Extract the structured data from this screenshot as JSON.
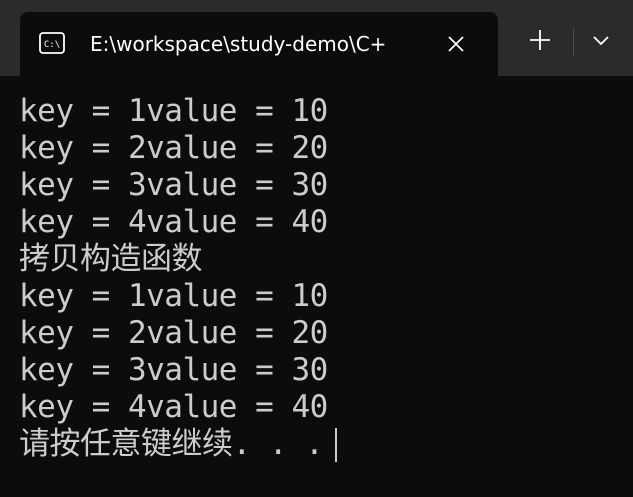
{
  "tab": {
    "title": "E:\\workspace\\study-demo\\C+",
    "icon": "terminal-icon",
    "close_icon": "close-icon"
  },
  "toolbar": {
    "new_tab_icon": "plus-icon",
    "dropdown_icon": "chevron-down-icon"
  },
  "console": {
    "lines": [
      "key = 1value = 10",
      "key = 2value = 20",
      "key = 3value = 30",
      "key = 4value = 40",
      "拷贝构造函数",
      "key = 1value = 10",
      "key = 2value = 20",
      "key = 3value = 30",
      "key = 4value = 40",
      "请按任意键继续. . ."
    ]
  },
  "colors": {
    "titlebar_bg": "#2b2b2b",
    "console_bg": "#0c0c0c",
    "console_text": "#cccccc"
  }
}
